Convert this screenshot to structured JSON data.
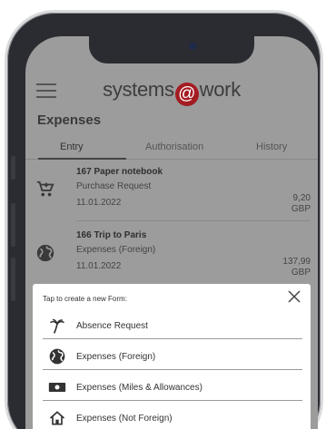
{
  "brand": {
    "left": "systems",
    "at": "@",
    "right": "work",
    "accent": "#a31c22"
  },
  "section_title": "Expenses",
  "tabs": [
    {
      "label": "Entry",
      "active": true
    },
    {
      "label": "Authorisation",
      "active": false
    },
    {
      "label": "History",
      "active": false
    }
  ],
  "entries": [
    {
      "icon": "cart-icon",
      "title": "167 Paper notebook",
      "type": "Purchase Request",
      "date": "11.01.2022",
      "amount": "9,20",
      "currency": "GBP"
    },
    {
      "icon": "globe-icon",
      "title": "166 Trip to Paris",
      "type": "Expenses (Foreign)",
      "date": "11.01.2022",
      "amount": "137,99",
      "currency": "GBP"
    }
  ],
  "sheet": {
    "title": "Tap to create a new Form:",
    "options": [
      {
        "icon": "palm-tree-icon",
        "label": "Absence Request"
      },
      {
        "icon": "globe-icon",
        "label": "Expenses (Foreign)"
      },
      {
        "icon": "banknote-icon",
        "label": "Expenses (Miles & Allowances)"
      },
      {
        "icon": "home-icon",
        "label": "Expenses (Not Foreign)"
      }
    ]
  }
}
